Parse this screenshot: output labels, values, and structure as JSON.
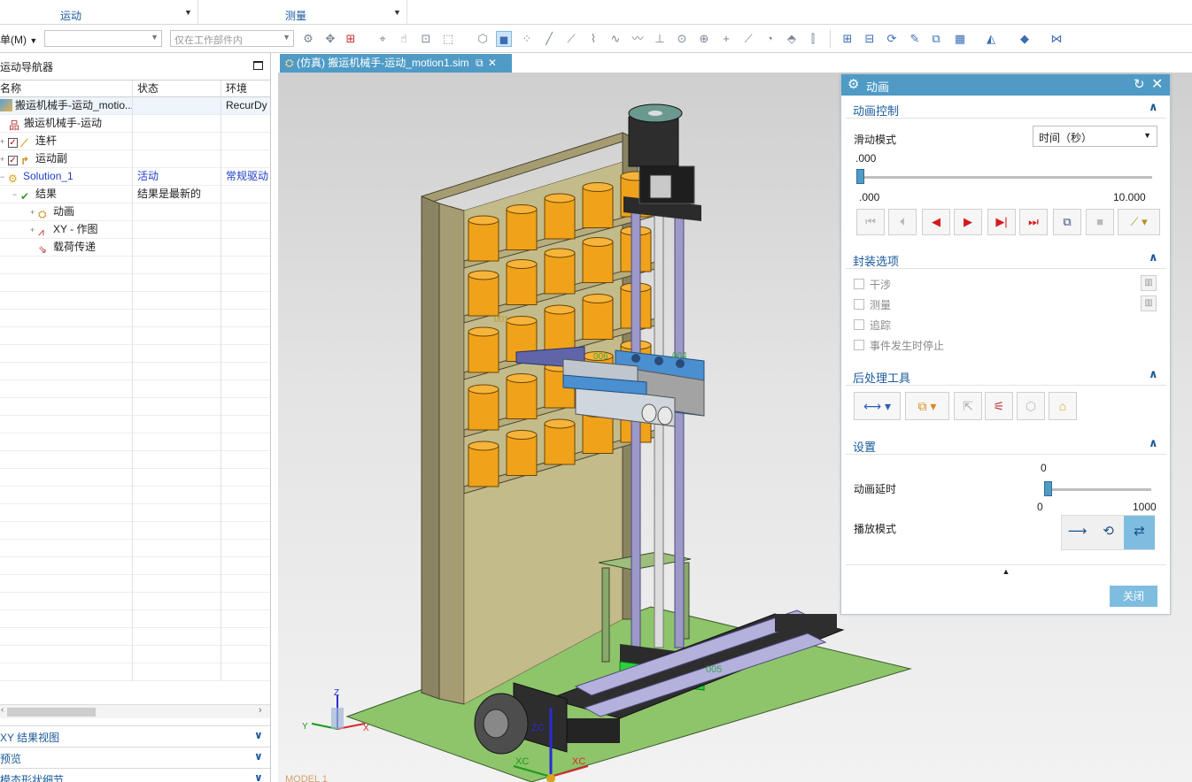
{
  "ribbon": {
    "groups": [
      {
        "label": "运动"
      },
      {
        "label": "测量"
      }
    ]
  },
  "toolbar": {
    "menu_label": "单(M)",
    "filter_combo_value": "",
    "scope_combo_value": "仅在工作部件内"
  },
  "navigator": {
    "title": "运动导航器",
    "columns": {
      "name": "名称",
      "status": "状态",
      "env": "环境"
    },
    "rows": [
      {
        "name": "搬运机械手-运动_motio...",
        "status": "",
        "env": "RecurDy",
        "icon": "sim-icon"
      },
      {
        "name": "搬运机械手-运动",
        "status": "",
        "env": "",
        "icon": "assembly-icon"
      },
      {
        "name": "连杆",
        "status": "",
        "env": "",
        "icon": "link-icon"
      },
      {
        "name": "运动副",
        "status": "",
        "env": "",
        "icon": "joint-icon"
      },
      {
        "name": "Solution_1",
        "status": "活动",
        "env": "常规驱动",
        "icon": "solution-icon"
      },
      {
        "name": "结果",
        "status": "结果是最新的",
        "env": "",
        "icon": "result-icon"
      },
      {
        "name": "动画",
        "status": "",
        "env": "",
        "icon": "animation-icon"
      },
      {
        "name": "XY - 作图",
        "status": "",
        "env": "",
        "icon": "xy-graph-icon"
      },
      {
        "name": "载荷传递",
        "status": "",
        "env": "",
        "icon": "load-transfer-icon"
      }
    ],
    "sections": [
      {
        "label": "XY 结果视图"
      },
      {
        "label": "预览"
      },
      {
        "label": "模态形状细节"
      }
    ]
  },
  "tab": {
    "title": "(仿真) 搬运机械手-运动_motion1.sim"
  },
  "viewport": {
    "labels": {
      "a": "001",
      "b": "006",
      "c": "004",
      "d": "005",
      "xc": "XC",
      "zc": "ZC",
      "x": "X",
      "y": "Y",
      "z": "Z",
      "model": "MODEL 1"
    }
  },
  "dialog": {
    "title": "动画",
    "control": {
      "header": "动画控制",
      "slide_mode_label": "滑动模式",
      "slide_mode_value": "时间（秒）",
      "current_value": ".000",
      "min_label": ".000",
      "max_label": "10.000",
      "progress": 0.0
    },
    "package": {
      "header": "封装选项",
      "options": [
        {
          "label": "干涉"
        },
        {
          "label": "测量"
        },
        {
          "label": "追踪"
        },
        {
          "label": "事件发生时停止"
        }
      ]
    },
    "postprocess": {
      "header": "后处理工具"
    },
    "settings": {
      "header": "设置",
      "delay_label": "动画延时",
      "delay_value": "0",
      "delay_min": "0",
      "delay_max": "1000",
      "delay_level": 0.0,
      "play_mode_label": "播放模式"
    },
    "close_label": "关闭"
  }
}
